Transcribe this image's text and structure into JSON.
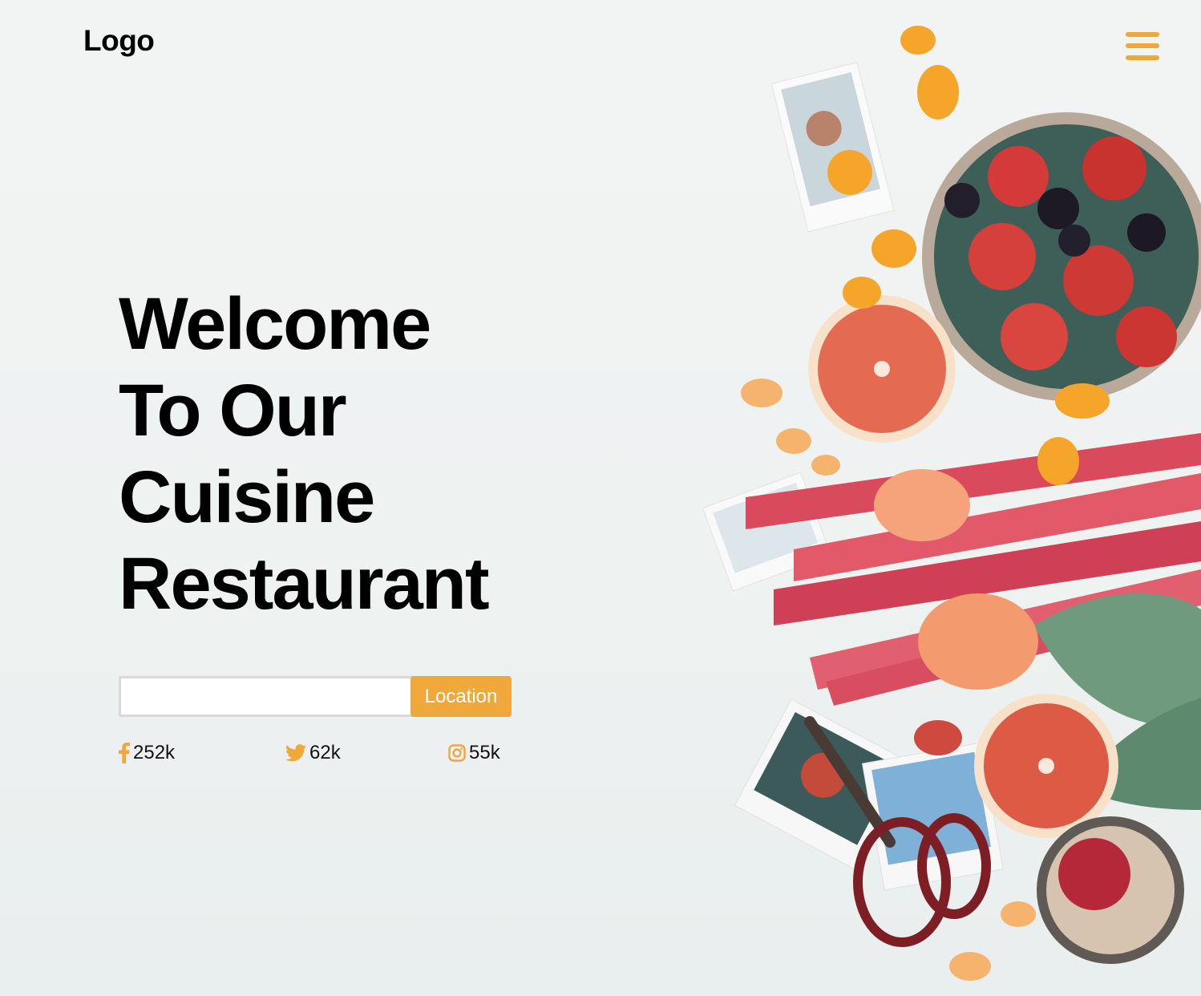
{
  "header": {
    "logo": "Logo",
    "menu_icon": "hamburger-menu-icon"
  },
  "hero": {
    "title_lines": [
      "Welcome",
      "To Our",
      "Cuisine",
      "Restaurant"
    ]
  },
  "search": {
    "value": "",
    "placeholder": "",
    "button_label": "Location"
  },
  "social": [
    {
      "icon": "facebook-icon",
      "count": "252k"
    },
    {
      "icon": "twitter-icon",
      "count": "62k"
    },
    {
      "icon": "instagram-icon",
      "count": "55k"
    }
  ],
  "colors": {
    "accent": "#f0a83a",
    "text": "#000000",
    "background": "#f0f3f2"
  }
}
